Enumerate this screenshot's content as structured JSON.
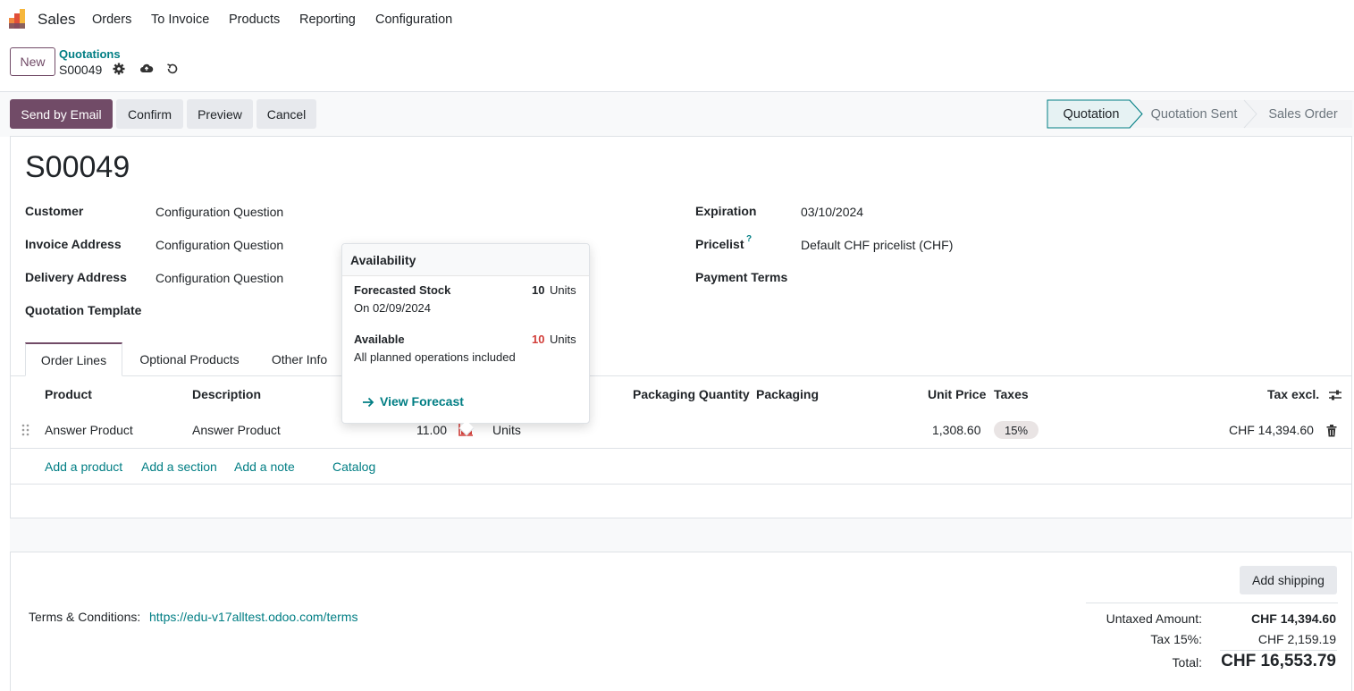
{
  "app": {
    "name": "Sales"
  },
  "nav": {
    "items": [
      "Orders",
      "To Invoice",
      "Products",
      "Reporting",
      "Configuration"
    ]
  },
  "control_panel": {
    "new_label": "New",
    "breadcrumb_parent": "Quotations",
    "breadcrumb_current": "S00049"
  },
  "actions": {
    "send_email": "Send by Email",
    "confirm": "Confirm",
    "preview": "Preview",
    "cancel": "Cancel"
  },
  "stages": {
    "items": [
      "Quotation",
      "Quotation Sent",
      "Sales Order"
    ],
    "active": "Quotation"
  },
  "record": {
    "name": "S00049",
    "customer_label": "Customer",
    "customer_value": "Configuration Question",
    "invoice_label": "Invoice Address",
    "invoice_value": "Configuration Question",
    "delivery_label": "Delivery Address",
    "delivery_value": "Configuration Question",
    "template_label": "Quotation Template",
    "expiration_label": "Expiration",
    "expiration_value": "03/10/2024",
    "pricelist_label": "Pricelist",
    "pricelist_help": "?",
    "pricelist_value": "Default CHF pricelist (CHF)",
    "payment_terms_label": "Payment Terms"
  },
  "tabs": [
    "Order Lines",
    "Optional Products",
    "Other Info"
  ],
  "order_lines": {
    "headers": {
      "product": "Product",
      "description": "Description",
      "packaging_qty": "Packaging Quantity",
      "packaging": "Packaging",
      "unit_price": "Unit Price",
      "taxes": "Taxes",
      "tax_excl": "Tax excl."
    },
    "row": {
      "product": "Answer Product",
      "description": "Answer Product",
      "quantity": "11.00",
      "uom": "Units",
      "unit_price": "1,308.60",
      "tax": "15%",
      "subtotal": "CHF 14,394.60"
    },
    "add_product": "Add a product",
    "add_section": "Add a section",
    "add_note": "Add a note",
    "catalog": "Catalog"
  },
  "popover": {
    "title": "Availability",
    "forecast_label": "Forecasted Stock",
    "forecast_qty": "10",
    "forecast_unit": "Units",
    "forecast_date": "On 02/09/2024",
    "available_label": "Available",
    "available_qty": "10",
    "available_unit": "Units",
    "available_note": "All planned operations included",
    "view_forecast": "View Forecast"
  },
  "footer": {
    "terms_label": "Terms & Conditions:",
    "terms_link": "https://edu-v17alltest.odoo.com/terms",
    "add_shipping": "Add shipping",
    "untaxed_label": "Untaxed Amount:",
    "untaxed_value": "CHF 14,394.60",
    "tax_label": "Tax 15%:",
    "tax_value": "CHF 2,159.19",
    "total_label": "Total:",
    "total_value": "CHF 16,553.79"
  },
  "colors": {
    "primary": "#714b67",
    "link": "#017e84",
    "danger": "#d23f3a",
    "stage_active_bg": "#e6f2f3"
  }
}
